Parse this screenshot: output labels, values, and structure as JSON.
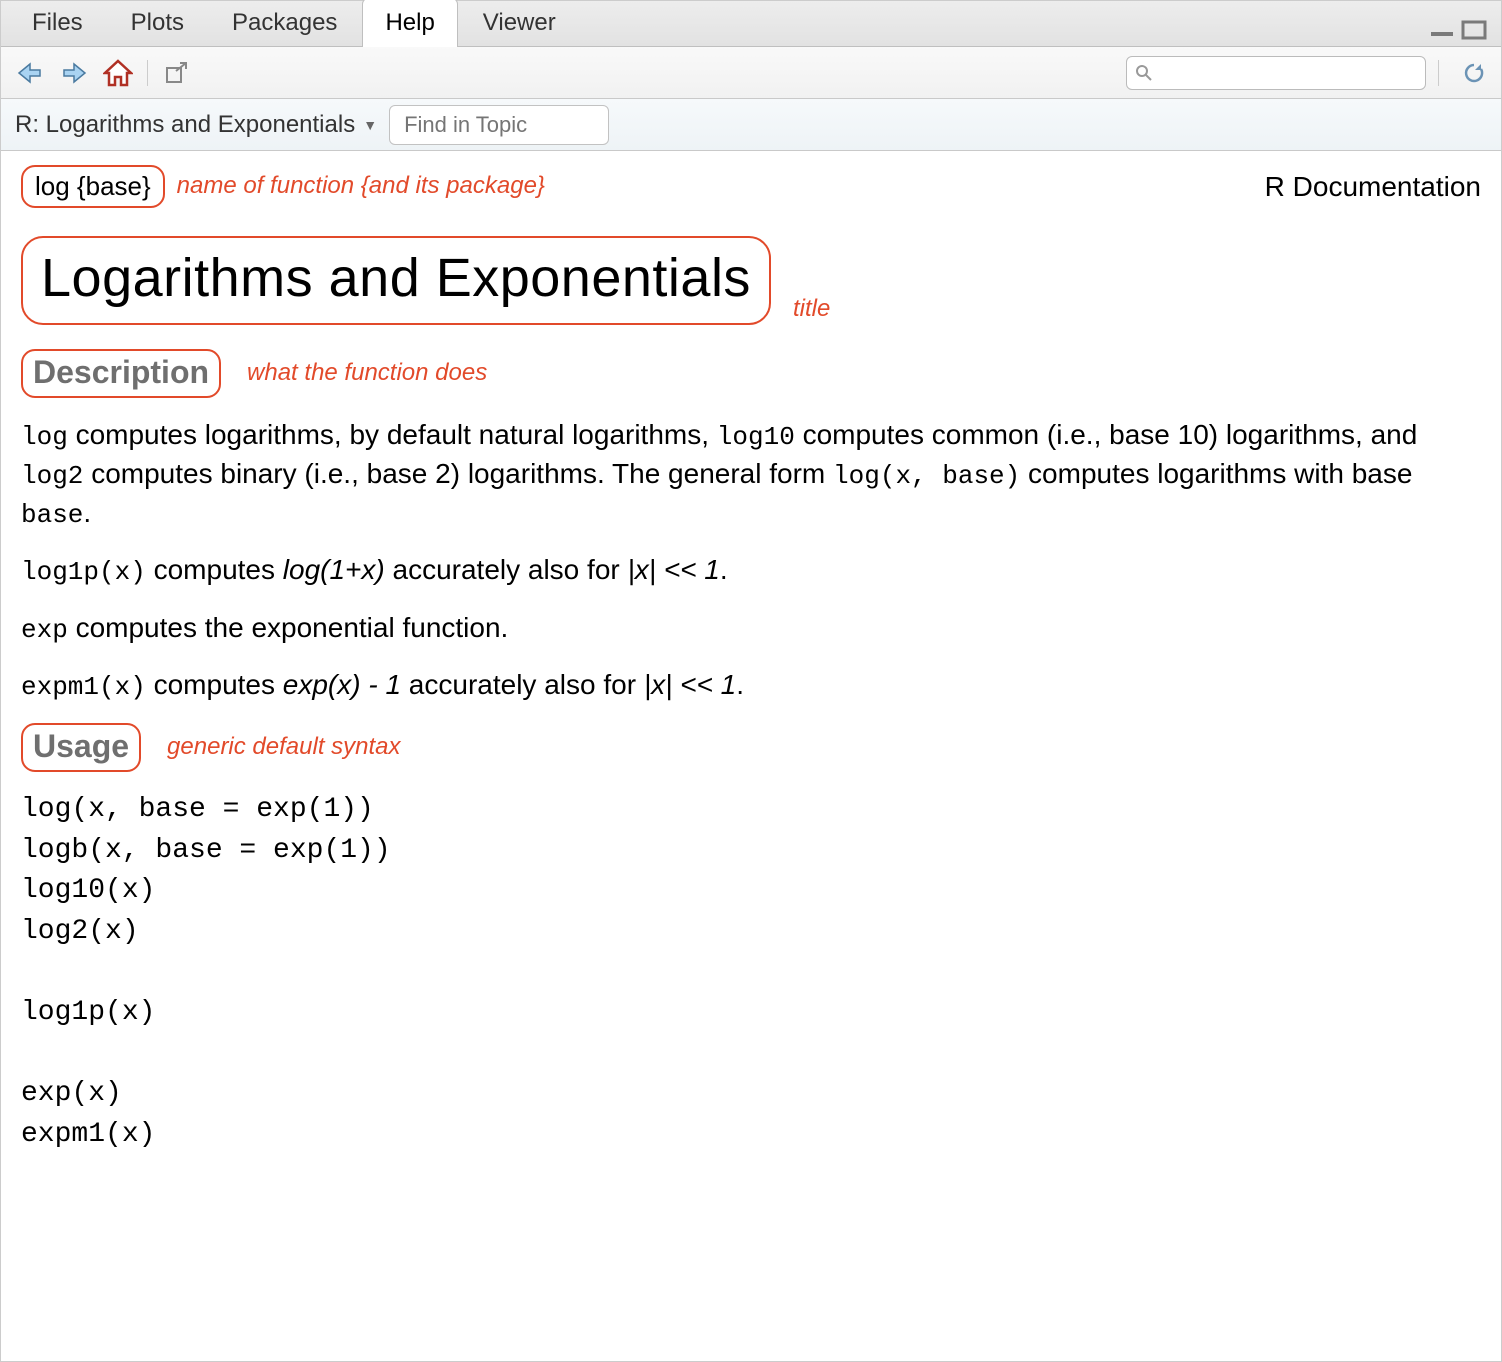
{
  "tabs": {
    "items": [
      "Files",
      "Plots",
      "Packages",
      "Help",
      "Viewer"
    ],
    "active_index": 3
  },
  "navbar": {
    "search_placeholder": ""
  },
  "crumb": {
    "label": "R: Logarithms and Exponentials",
    "find_placeholder": "Find in Topic"
  },
  "doc": {
    "fn_badge": "log {base}",
    "fn_badge_annot": "name of function {and its package}",
    "rdoc": "R Documentation",
    "title": "Logarithms and Exponentials",
    "title_annot": "title",
    "sec_description": "Description",
    "sec_description_annot": "what the function does",
    "desc": {
      "p1a": "log",
      "p1b": " computes logarithms, by default natural logarithms, ",
      "p1c": "log10",
      "p1d": " computes common (i.e., base 10) logarithms, and ",
      "p1e": "log2",
      "p1f": " computes binary (i.e., base 2) logarithms. The general form ",
      "p1g": "log(x, base)",
      "p1h": " computes logarithms with base ",
      "p1i": "base",
      "p1j": ".",
      "p2a": "log1p(x)",
      "p2b": " computes ",
      "p2c": "log(1+x)",
      "p2d": " accurately also for ",
      "p2e": "|x| << 1",
      "p2f": ".",
      "p3a": "exp",
      "p3b": " computes the exponential function.",
      "p4a": "expm1(x)",
      "p4b": " computes ",
      "p4c": "exp(x) - 1",
      "p4d": " accurately also for ",
      "p4e": "|x| << 1",
      "p4f": "."
    },
    "sec_usage": "Usage",
    "sec_usage_annot": "generic default syntax",
    "usage_code": "log(x, base = exp(1))\nlogb(x, base = exp(1))\nlog10(x)\nlog2(x)\n\nlog1p(x)\n\nexp(x)\nexpm1(x)"
  }
}
